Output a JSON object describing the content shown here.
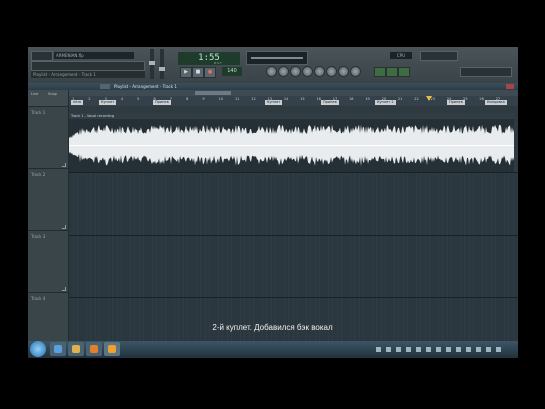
{
  "toolbar": {
    "file_name": "ARMENIAN.flp",
    "hint": "Playlist - Arrangement - Track 1",
    "time": "1:55",
    "time_sub": "B:S:T",
    "tempo": "140",
    "cpu": "CPU",
    "transport": {
      "play": "▶",
      "stop": "■",
      "record": "●"
    }
  },
  "window": {
    "title": "Playlist - Arrangement - Track 1"
  },
  "left_header": {
    "label1": "Line",
    "label2": "Snap"
  },
  "tracks": [
    {
      "name": "Track 1"
    },
    {
      "name": "Track 2"
    },
    {
      "name": "Track 3"
    },
    {
      "name": "Track 4"
    }
  ],
  "ruler": {
    "ticks": [
      "1",
      "2",
      "3",
      "4",
      "5",
      "6",
      "7",
      "8",
      "9",
      "10",
      "11",
      "12",
      "13",
      "14",
      "15",
      "16",
      "17",
      "18",
      "19",
      "20",
      "21",
      "22",
      "23",
      "24",
      "25",
      "26",
      "27"
    ],
    "markers": [
      "Intro",
      "Куплет",
      "Припев",
      "Куплет",
      "Припев",
      "Куплет 2",
      "Припев",
      "Концовка"
    ]
  },
  "clip": {
    "title": "Track 1 - Vocal recording"
  },
  "subtitle": "2-й куплет. Добавился бэк вокал",
  "taskbar": {
    "apps": [
      "ie",
      "explorer",
      "media",
      "fl-studio"
    ]
  }
}
